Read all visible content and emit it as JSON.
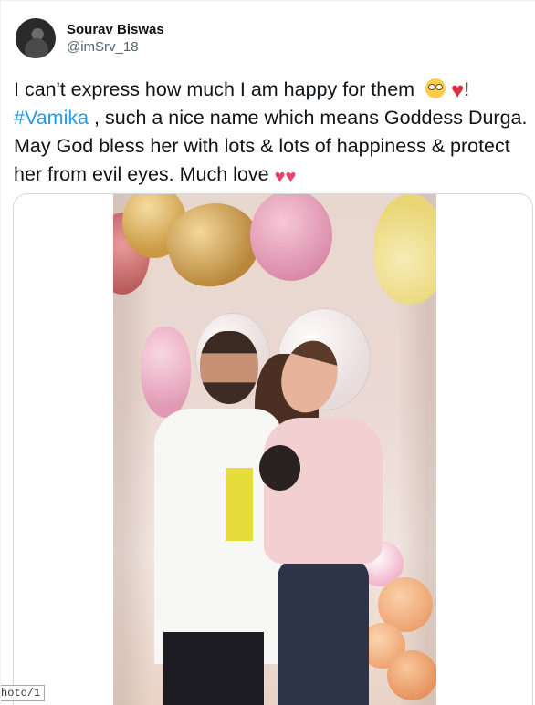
{
  "author": {
    "display_name": "Sourav Biswas",
    "handle": "@imSrv_18"
  },
  "tweet": {
    "line1_text": "I can't express how much I am happy for them ",
    "line1_end": "!",
    "hashtag": "#Vamika",
    "rest_text": " , such a nice name which means Goddess Durga. May God bless her with lots & lots of happiness & protect her from evil eyes. Much love ",
    "emojis": [
      "face-with-rolling-eyes",
      "red-heart",
      "two-hearts"
    ]
  },
  "media": {
    "type": "photo",
    "alt_hint": "couple-with-newborn-photo"
  },
  "overlay": {
    "photo_tag": "hoto/1"
  }
}
